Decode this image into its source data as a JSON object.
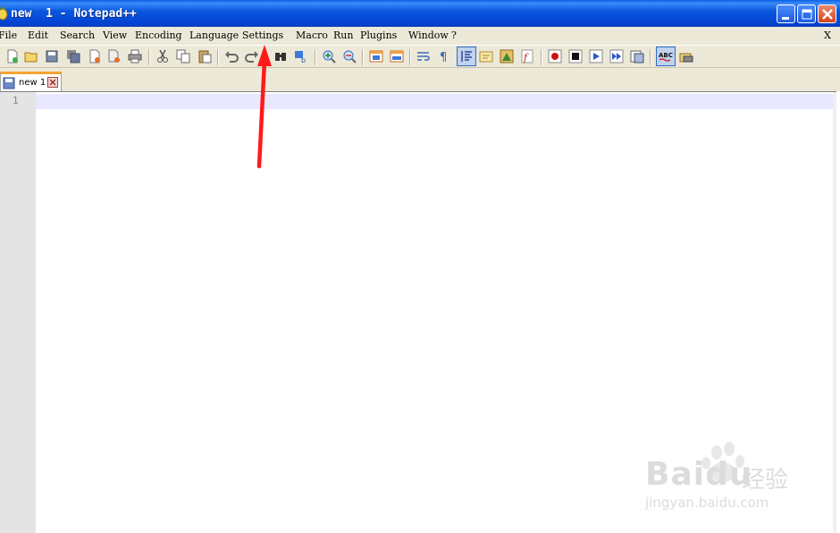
{
  "window": {
    "title": "new  1 - Notepad++"
  },
  "menu": {
    "items": [
      "File",
      "Edit",
      "Search",
      "View",
      "Encoding",
      "Language",
      "Settings",
      "Macro",
      "Run",
      "Plugins",
      "Window",
      "?"
    ],
    "close_label": "X"
  },
  "toolbar": {
    "icons": [
      "new-file",
      "open-file",
      "save",
      "save-all",
      "close",
      "close-all",
      "print",
      "cut",
      "copy",
      "paste",
      "undo",
      "redo",
      "find",
      "replace",
      "zoom-in",
      "zoom-out",
      "sync-v",
      "sync-h",
      "word-wrap",
      "show-all-chars",
      "indent-guide",
      "user-define-lang",
      "doc-map",
      "function-list",
      "record-macro",
      "stop-macro",
      "play-macro",
      "run-macro-multiple",
      "save-macro",
      "spell-check",
      "spell-settings"
    ],
    "active_icon": "indent-guide"
  },
  "tabs": [
    {
      "label": "new  1",
      "active": true
    }
  ],
  "editor": {
    "line_numbers": [
      "1"
    ]
  },
  "watermark": {
    "brand": "Baidu",
    "cn": "经验",
    "url": "jingyan.baidu.com"
  },
  "colors": {
    "titlebar": "#0343d2",
    "chrome": "#ece9d8",
    "tab_accent": "#f6a332",
    "current_line": "#e8e8ff",
    "arrow": "#ff1a1a"
  }
}
